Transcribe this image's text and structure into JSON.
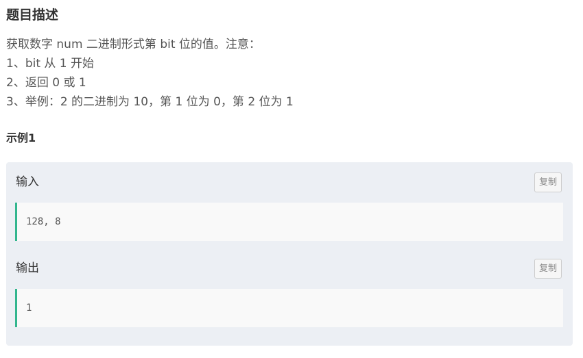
{
  "problem": {
    "title": "题目描述",
    "lines": [
      "获取数字 num 二进制形式第 bit 位的值。注意：",
      "1、bit 从 1 开始",
      "2、返回 0 或 1",
      "3、举例：2 的二进制为 10，第 1 位为 0，第 2 位为 1"
    ]
  },
  "example": {
    "title": "示例1",
    "input_label": "输入",
    "input_value": "128, 8",
    "output_label": "输出",
    "output_value": "1",
    "copy_label": "复制"
  },
  "colors": {
    "accent": "#32b68e",
    "example_bg": "#eceff4",
    "code_bg": "#f9f9f9"
  }
}
